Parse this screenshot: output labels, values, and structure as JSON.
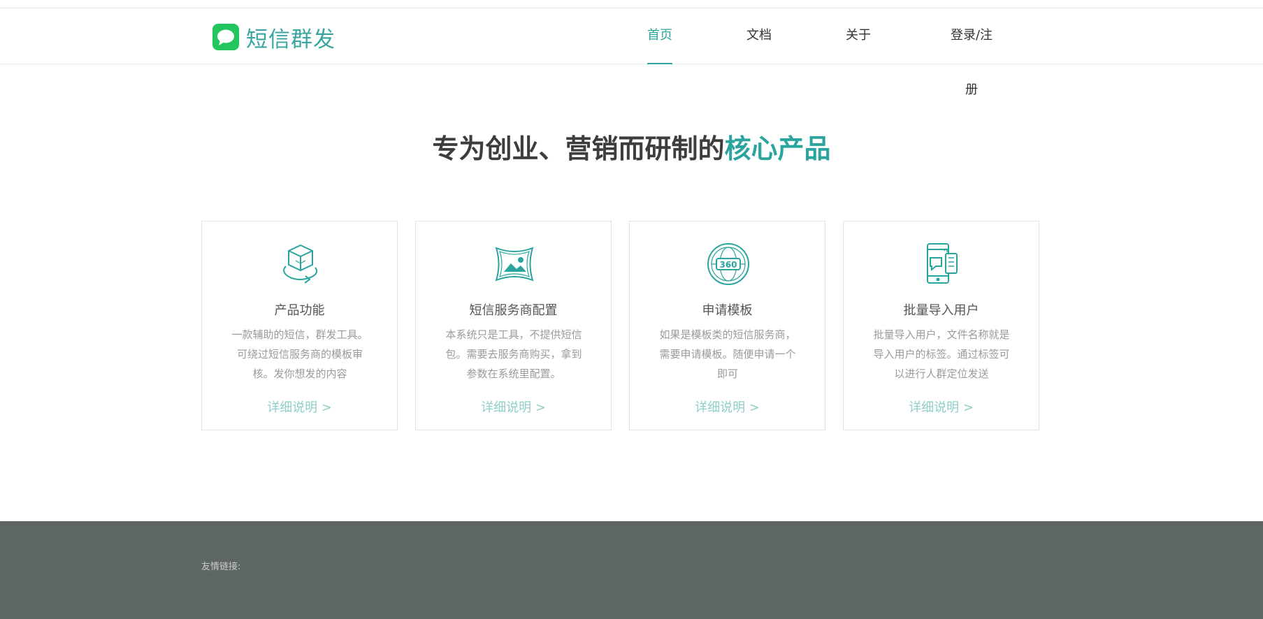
{
  "brand": {
    "name": "短信群发",
    "accent_color": "#2aa59d",
    "logo_icon": "chat-bubble-icon",
    "logo_color": "#22c55e"
  },
  "nav": {
    "items": [
      {
        "label": "首页",
        "active": true
      },
      {
        "label": "文档",
        "active": false
      },
      {
        "label": "关于",
        "active": false
      },
      {
        "label": "登录/注册",
        "active": false
      }
    ]
  },
  "hero": {
    "title_main": "专为创业、营销而研制的",
    "title_accent": "核心产品"
  },
  "features": [
    {
      "icon": "rotating-cube-icon",
      "title": "产品功能",
      "description": "一款辅助的短信，群发工具。可绕过短信服务商的模板审核。发你想发的内容",
      "link": "详细说明 >"
    },
    {
      "icon": "panorama-image-icon",
      "title": "短信服务商配置",
      "description": "本系统只是工具，不提供短信包。需要去服务商购买，拿到参数在系统里配置。",
      "link": "详细说明 >"
    },
    {
      "icon": "globe-360-icon",
      "title": "申请模板",
      "description": "如果是模板类的短信服务商，需要申请模板。随便申请一个即可",
      "link": "详细说明 >"
    },
    {
      "icon": "mobile-message-icon",
      "title": "批量导入用户",
      "description": "批量导入用户，文件名称就是导入用户的标签。通过标签可以进行人群定位发送",
      "link": "详细说明 >"
    }
  ],
  "footer": {
    "links_label": "友情链接:"
  }
}
